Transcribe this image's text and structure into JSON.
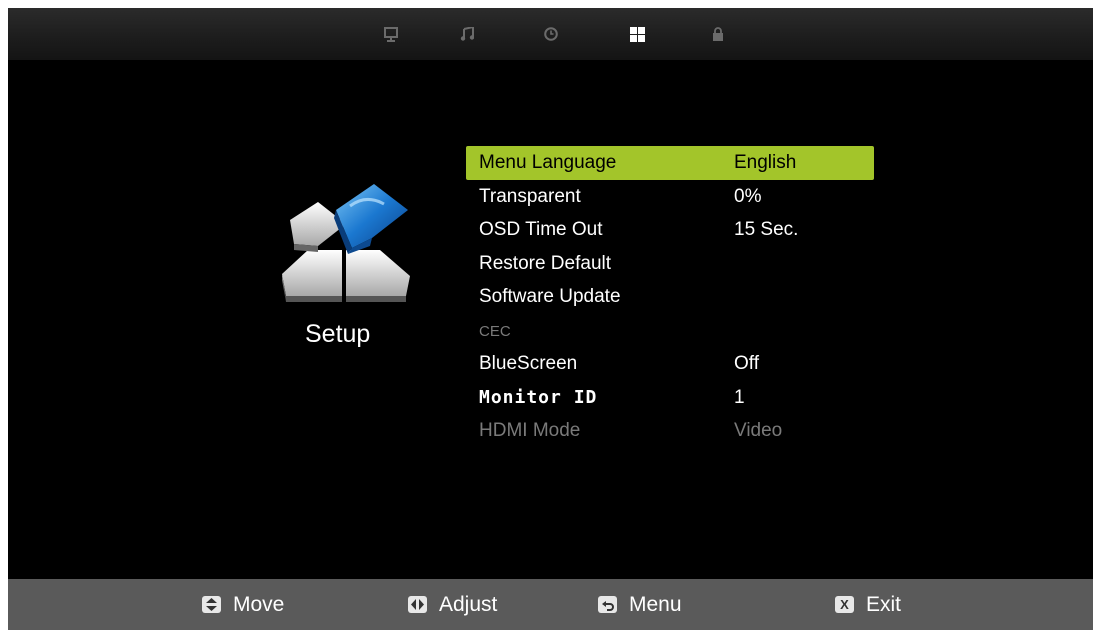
{
  "tabs": [
    {
      "icon": "picture-icon"
    },
    {
      "icon": "sound-icon"
    },
    {
      "icon": "time-icon"
    },
    {
      "icon": "setup-icon",
      "active": true
    },
    {
      "icon": "lock-icon"
    }
  ],
  "page": {
    "title": "Setup",
    "icon": "setup-blocks-icon"
  },
  "menu": {
    "items": [
      {
        "label": "Menu Language",
        "value": "English",
        "selected": true
      },
      {
        "label": "Transparent",
        "value": "0%"
      },
      {
        "label": "OSD Time Out",
        "value": "15 Sec."
      },
      {
        "label": "Restore Default",
        "value": ""
      },
      {
        "label": "Software Update",
        "value": ""
      },
      {
        "label": "CEC",
        "value": "",
        "disabled": true
      },
      {
        "label": "BlueScreen",
        "value": "Off"
      },
      {
        "label": "Monitor ID",
        "value": "1"
      },
      {
        "label": "HDMI Mode",
        "value": "Video",
        "disabled": true
      }
    ]
  },
  "help": {
    "move": {
      "key": "up-down-key-icon",
      "label": "Move"
    },
    "adjust": {
      "key": "left-right-key-icon",
      "label": "Adjust"
    },
    "menu": {
      "key": "return-key-icon",
      "label": "Menu"
    },
    "exit": {
      "key": "x-key-icon",
      "key_glyph": "X",
      "label": "Exit"
    }
  },
  "colors": {
    "selection": "#a3c52a",
    "background": "#000000",
    "helpbar": "#5a5a5a",
    "disabled_text": "#7a7a7a"
  }
}
